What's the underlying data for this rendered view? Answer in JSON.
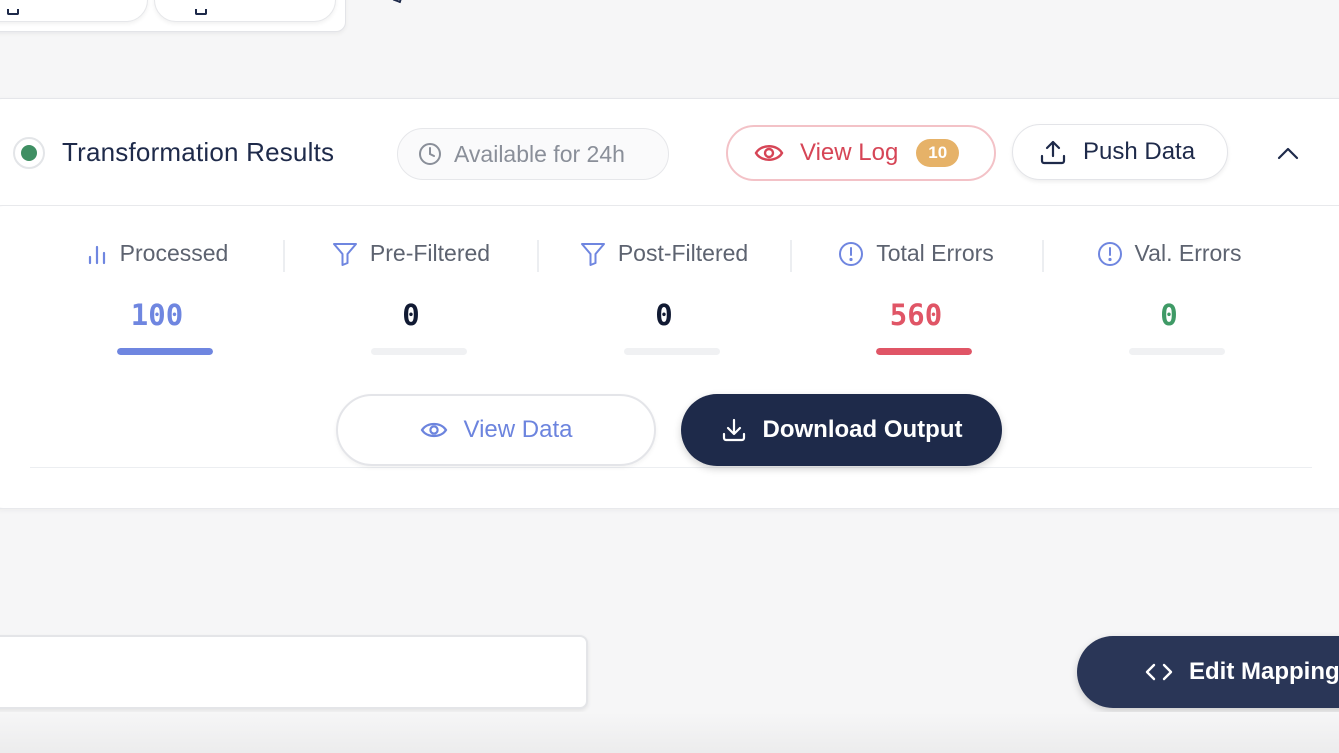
{
  "results": {
    "title": "Transformation Results",
    "availability": "Available for 24h",
    "view_log_label": "View Log",
    "view_log_count": "10",
    "push_label": "Push Data"
  },
  "stats": [
    {
      "label": "Processed",
      "value": "100",
      "icon": "bar-chart-icon",
      "color": "#6f86e0",
      "fill": 1.0
    },
    {
      "label": "Pre-Filtered",
      "value": "0",
      "icon": "filter-icon",
      "color": "#111a33",
      "fill": 0
    },
    {
      "label": "Post-Filtered",
      "value": "0",
      "icon": "filter-icon",
      "color": "#111a33",
      "fill": 0
    },
    {
      "label": "Total Errors",
      "value": "560",
      "icon": "alert-circle-icon",
      "color": "#e05566",
      "fill": 1.0
    },
    {
      "label": "Val. Errors",
      "value": "0",
      "icon": "alert-circle-icon",
      "color": "#3f9a66",
      "fill": 0
    }
  ],
  "actions": {
    "view_data_label": "View Data",
    "download_label": "Download Output"
  },
  "footer": {
    "edit_mapping_label": "Edit Mapping"
  },
  "colors": {
    "navy": "#1e2a4a",
    "accent_blue": "#6c84de",
    "error_red": "#d64556",
    "badge_amber": "#e6b268",
    "success_green": "#3f8f63"
  }
}
